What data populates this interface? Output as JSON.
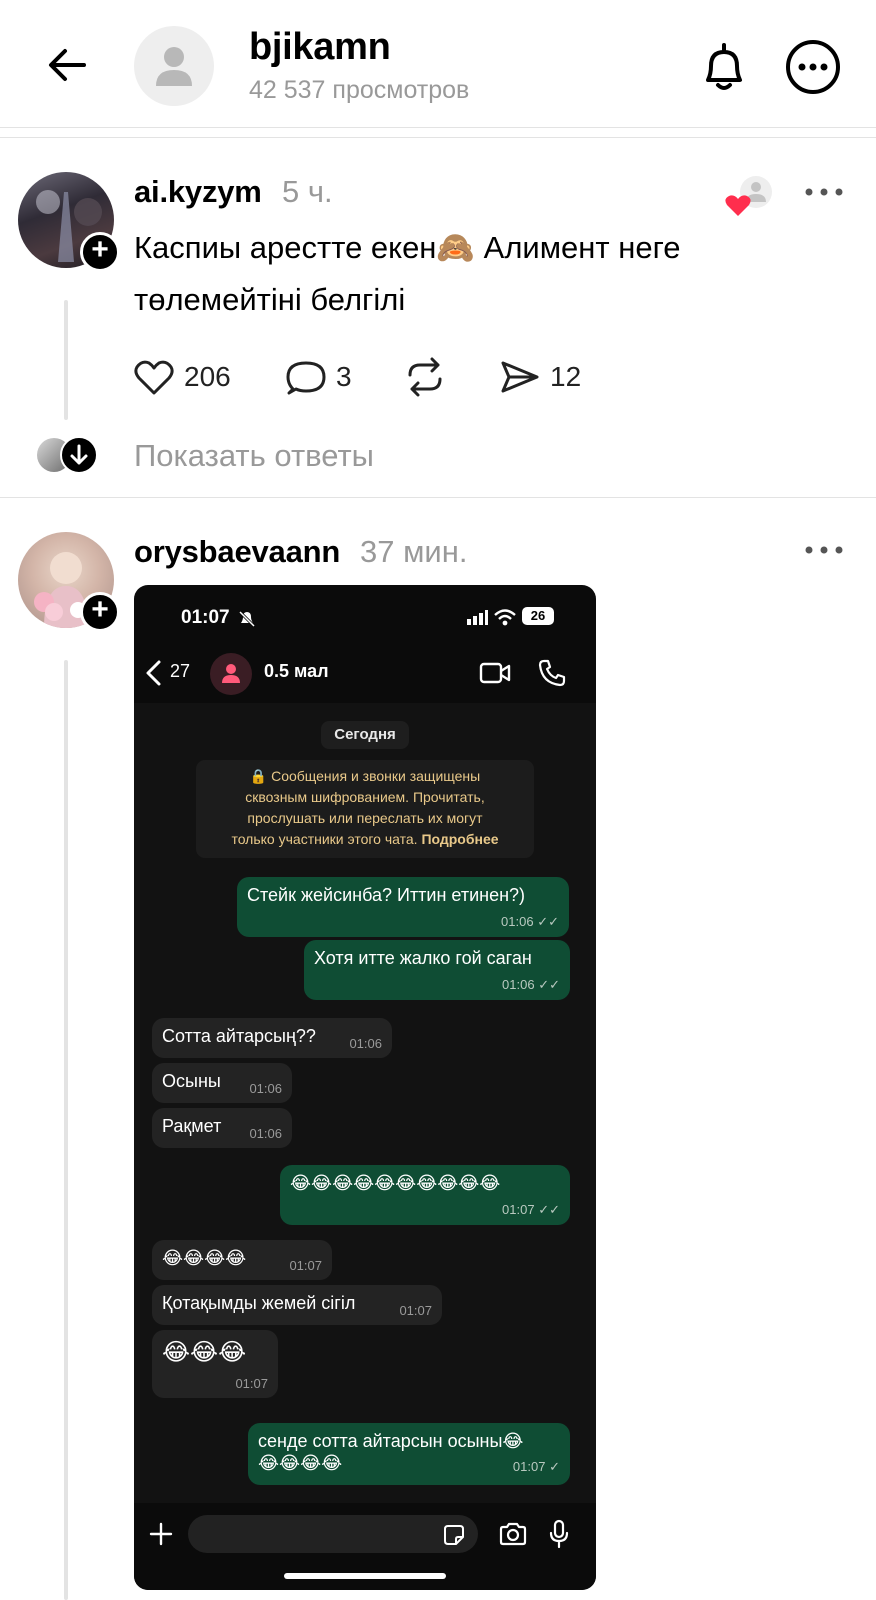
{
  "header": {
    "title": "bjikamn",
    "views": "42 537 просмотров"
  },
  "posts": [
    {
      "username": "ai.kyzym",
      "time": "5 ч.",
      "text_line1": "Каспиы арестте екен🙈 Алимент неге",
      "text_line2": "төлемейтіні белгілі",
      "likes": "206",
      "comments": "3",
      "shares": "12",
      "show_replies": "Показать ответы"
    },
    {
      "username": "orysbaevaann",
      "time": "37 мин."
    }
  ],
  "screenshot": {
    "status_time": "01:07",
    "battery": "26",
    "back_count": "27",
    "contact_name": "0.5 мал",
    "date_label": "Сегодня",
    "e2e_line1": "🔒 Сообщения и звонки защищены",
    "e2e_line2": "сквозным шифрованием. Прочитать,",
    "e2e_line3": "прослушать или переслать их могут",
    "e2e_line4": "только участники этого чата.",
    "e2e_more": "Подробнее",
    "messages": [
      {
        "text": "Стейк жейсинба? Иттин етинен?)",
        "time": "01:06",
        "ticks": "✓✓"
      },
      {
        "text": "Хотя итте жалко гой саган",
        "time": "01:06",
        "ticks": "✓✓"
      },
      {
        "text": "Сотта айтарсың??",
        "time": "01:06"
      },
      {
        "text": "Осыны",
        "time": "01:06"
      },
      {
        "text": "Рақмет",
        "time": "01:06"
      },
      {
        "text": "😂😂😂😂😂😂😂😂😂😂",
        "time": "01:07",
        "ticks": "✓✓"
      },
      {
        "text": "😂😂😂😂",
        "time": "01:07"
      },
      {
        "text": "Қотақымды жемей сігіл",
        "time": "01:07"
      },
      {
        "text": "😂😂😂",
        "time": "01:07"
      },
      {
        "text": "сенде сотта айтарсын осыны😂",
        "text2": "😂😂😂😂",
        "time": "01:07",
        "ticks": "✓"
      }
    ]
  }
}
